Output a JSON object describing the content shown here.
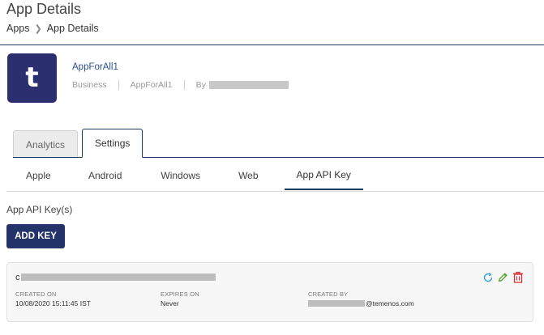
{
  "header": {
    "title": "App Details",
    "breadcrumb": {
      "root": "Apps",
      "current": "App Details"
    }
  },
  "app": {
    "logo_letter": "t",
    "name": "AppForAll1",
    "category": "Business",
    "identifier": "AppForAll1",
    "by_label": "By"
  },
  "tabs": [
    {
      "label": "Analytics",
      "active": false
    },
    {
      "label": "Settings",
      "active": true
    }
  ],
  "subtabs": [
    {
      "label": "Apple",
      "active": false
    },
    {
      "label": "Android",
      "active": false
    },
    {
      "label": "Windows",
      "active": false
    },
    {
      "label": "Web",
      "active": false
    },
    {
      "label": "App API Key",
      "active": true
    }
  ],
  "api_keys": {
    "section_label": "App API Key(s)",
    "add_button_label": "ADD KEY",
    "items": [
      {
        "key_visible_prefix": "c",
        "created_on_label": "CREATED ON",
        "created_on_value": "10/08/2020 15:11:45 IST",
        "expires_on_label": "EXPIRES ON",
        "expires_on_value": "Never",
        "created_by_label": "CREATED BY",
        "created_by_visible_suffix": "@temenos.com"
      }
    ]
  },
  "colors": {
    "brand_navy": "#25336b",
    "rule_navy": "#1a3a5c",
    "link_blue": "#2d4e8f",
    "refresh_icon": "#3a9fd8",
    "edit_icon": "#5aa832",
    "delete_icon": "#d9313a"
  },
  "icons": [
    "refresh-icon",
    "edit-icon",
    "delete-icon"
  ]
}
